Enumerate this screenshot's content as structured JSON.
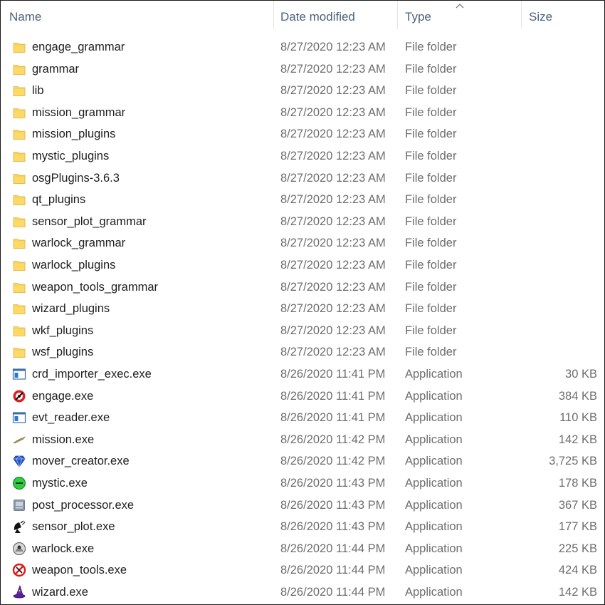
{
  "columns": {
    "name": "Name",
    "date": "Date modified",
    "type": "Type",
    "size": "Size"
  },
  "files": [
    {
      "name": "engage_grammar",
      "date": "8/27/2020 12:23 AM",
      "type": "File folder",
      "size": "",
      "icon": "folder-icon"
    },
    {
      "name": "grammar",
      "date": "8/27/2020 12:23 AM",
      "type": "File folder",
      "size": "",
      "icon": "folder-icon"
    },
    {
      "name": "lib",
      "date": "8/27/2020 12:23 AM",
      "type": "File folder",
      "size": "",
      "icon": "folder-icon"
    },
    {
      "name": "mission_grammar",
      "date": "8/27/2020 12:23 AM",
      "type": "File folder",
      "size": "",
      "icon": "folder-icon"
    },
    {
      "name": "mission_plugins",
      "date": "8/27/2020 12:23 AM",
      "type": "File folder",
      "size": "",
      "icon": "folder-icon"
    },
    {
      "name": "mystic_plugins",
      "date": "8/27/2020 12:23 AM",
      "type": "File folder",
      "size": "",
      "icon": "folder-icon"
    },
    {
      "name": "osgPlugins-3.6.3",
      "date": "8/27/2020 12:23 AM",
      "type": "File folder",
      "size": "",
      "icon": "folder-icon"
    },
    {
      "name": "qt_plugins",
      "date": "8/27/2020 12:23 AM",
      "type": "File folder",
      "size": "",
      "icon": "folder-icon"
    },
    {
      "name": "sensor_plot_grammar",
      "date": "8/27/2020 12:23 AM",
      "type": "File folder",
      "size": "",
      "icon": "folder-icon"
    },
    {
      "name": "warlock_grammar",
      "date": "8/27/2020 12:23 AM",
      "type": "File folder",
      "size": "",
      "icon": "folder-icon"
    },
    {
      "name": "warlock_plugins",
      "date": "8/27/2020 12:23 AM",
      "type": "File folder",
      "size": "",
      "icon": "folder-icon"
    },
    {
      "name": "weapon_tools_grammar",
      "date": "8/27/2020 12:23 AM",
      "type": "File folder",
      "size": "",
      "icon": "folder-icon"
    },
    {
      "name": "wizard_plugins",
      "date": "8/27/2020 12:23 AM",
      "type": "File folder",
      "size": "",
      "icon": "folder-icon"
    },
    {
      "name": "wkf_plugins",
      "date": "8/27/2020 12:23 AM",
      "type": "File folder",
      "size": "",
      "icon": "folder-icon"
    },
    {
      "name": "wsf_plugins",
      "date": "8/27/2020 12:23 AM",
      "type": "File folder",
      "size": "",
      "icon": "folder-icon"
    },
    {
      "name": "crd_importer_exec.exe",
      "date": "8/26/2020 11:41 PM",
      "type": "Application",
      "size": "30 KB",
      "icon": "window-app-icon"
    },
    {
      "name": "engage.exe",
      "date": "8/26/2020 11:41 PM",
      "type": "Application",
      "size": "384 KB",
      "icon": "engage-icon"
    },
    {
      "name": "evt_reader.exe",
      "date": "8/26/2020 11:41 PM",
      "type": "Application",
      "size": "110 KB",
      "icon": "window-app-icon"
    },
    {
      "name": "mission.exe",
      "date": "8/26/2020 11:42 PM",
      "type": "Application",
      "size": "142 KB",
      "icon": "mission-icon"
    },
    {
      "name": "mover_creator.exe",
      "date": "8/26/2020 11:42 PM",
      "type": "Application",
      "size": "3,725 KB",
      "icon": "mover-creator-icon"
    },
    {
      "name": "mystic.exe",
      "date": "8/26/2020 11:43 PM",
      "type": "Application",
      "size": "178 KB",
      "icon": "mystic-icon"
    },
    {
      "name": "post_processor.exe",
      "date": "8/26/2020 11:43 PM",
      "type": "Application",
      "size": "367 KB",
      "icon": "post-processor-icon"
    },
    {
      "name": "sensor_plot.exe",
      "date": "8/26/2020 11:43 PM",
      "type": "Application",
      "size": "177 KB",
      "icon": "satellite-dish-icon"
    },
    {
      "name": "warlock.exe",
      "date": "8/26/2020 11:44 PM",
      "type": "Application",
      "size": "225 KB",
      "icon": "warlock-icon"
    },
    {
      "name": "weapon_tools.exe",
      "date": "8/26/2020 11:44 PM",
      "type": "Application",
      "size": "424 KB",
      "icon": "weapon-tools-icon"
    },
    {
      "name": "wizard.exe",
      "date": "8/26/2020 11:44 PM",
      "type": "Application",
      "size": "142 KB",
      "icon": "wizard-hat-icon"
    }
  ],
  "colors": {
    "header_text": "#4c607a",
    "folder_fill": "#ffd966",
    "folder_edge": "#dcb040",
    "meta_text": "#6d6d6d"
  }
}
